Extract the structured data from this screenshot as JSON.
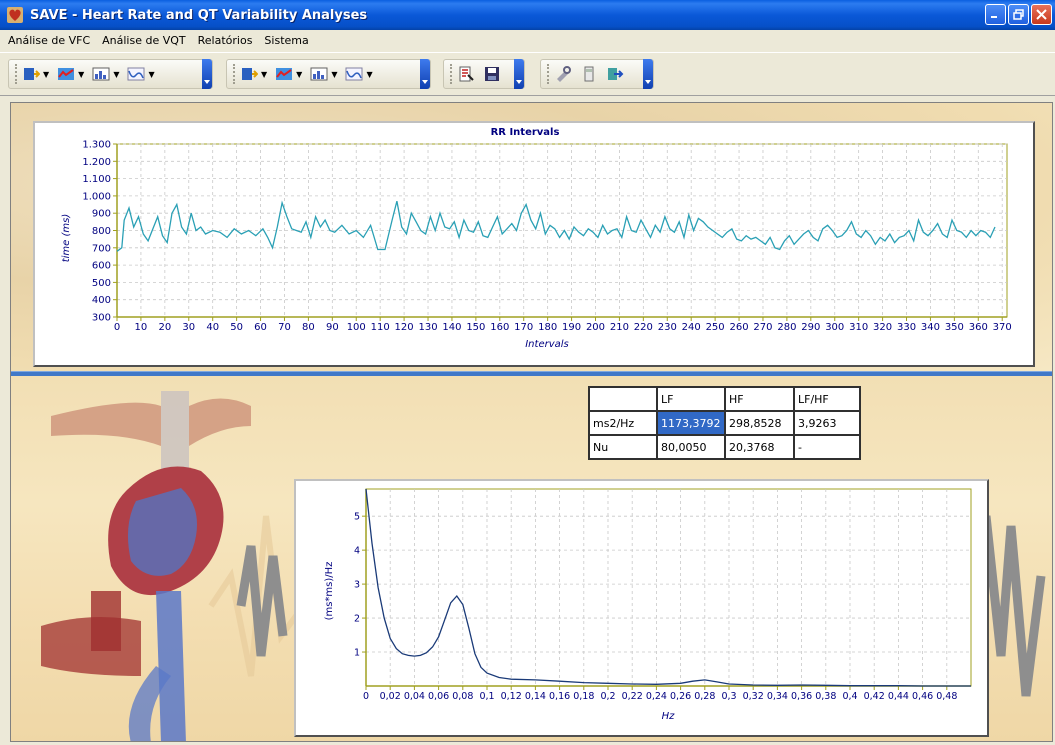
{
  "window": {
    "title": "SAVE - Heart Rate and QT Variability Analyses",
    "icon": "app-heart-icon"
  },
  "menu": {
    "items": [
      "Análise de VFC",
      "Análise de VQT",
      "Relatórios",
      "Sistema"
    ]
  },
  "toolbar": {
    "groups": [
      {
        "buttons": [
          "import-data-icon",
          "tachogram-icon",
          "histogram-icon",
          "spectrum-icon"
        ]
      },
      {
        "buttons": [
          "import-data-icon",
          "tachogram-icon",
          "histogram-icon",
          "spectrum-icon"
        ]
      },
      {
        "buttons": [
          "report-icon",
          "save-report-icon"
        ]
      },
      {
        "buttons": [
          "tools-icon",
          "calculator-icon",
          "exit-icon"
        ]
      }
    ]
  },
  "rr_chart": {
    "chart_data": {
      "type": "line",
      "title": "RR Intervals",
      "xlabel": "Intervals",
      "ylabel": "time (ms)",
      "xlim": [
        0,
        372
      ],
      "ylim": [
        300,
        1300
      ],
      "x_ticks": [
        "0",
        "10",
        "20",
        "30",
        "40",
        "50",
        "60",
        "70",
        "80",
        "90",
        "100",
        "110",
        "120",
        "130",
        "140",
        "150",
        "160",
        "170",
        "180",
        "190",
        "200",
        "210",
        "220",
        "230",
        "240",
        "250",
        "260",
        "270",
        "280",
        "290",
        "300",
        "310",
        "320",
        "330",
        "340",
        "350",
        "360",
        "370"
      ],
      "y_ticks": [
        "300",
        "400",
        "500",
        "600",
        "700",
        "800",
        "900",
        "1.000",
        "1.100",
        "1.200",
        "1.300"
      ],
      "series": [
        {
          "color": "#2aa0b5",
          "x": [
            0,
            2,
            3,
            5,
            7,
            9,
            11,
            13,
            15,
            17,
            19,
            21,
            23,
            25,
            27,
            29,
            31,
            33,
            35,
            37,
            40,
            43,
            46,
            49,
            52,
            55,
            58,
            61,
            63,
            65,
            67,
            69,
            71,
            73,
            75,
            77,
            79,
            81,
            83,
            85,
            87,
            89,
            91,
            94,
            97,
            100,
            103,
            106,
            109,
            112,
            115,
            117,
            119,
            121,
            123,
            125,
            127,
            129,
            131,
            133,
            135,
            137,
            139,
            141,
            143,
            145,
            147,
            149,
            151,
            153,
            155,
            157,
            159,
            161,
            163,
            165,
            167,
            169,
            171,
            173,
            175,
            177,
            179,
            181,
            183,
            185,
            187,
            189,
            191,
            193,
            195,
            197,
            199,
            201,
            203,
            205,
            207,
            209,
            211,
            213,
            215,
            217,
            219,
            221,
            223,
            225,
            227,
            229,
            231,
            233,
            235,
            237,
            239,
            241,
            243,
            245,
            247,
            249,
            251,
            253,
            255,
            257,
            259,
            261,
            263,
            265,
            267,
            269,
            271,
            273,
            275,
            277,
            279,
            281,
            283,
            285,
            287,
            289,
            291,
            293,
            295,
            297,
            299,
            301,
            303,
            305,
            307,
            309,
            311,
            313,
            315,
            317,
            319,
            321,
            323,
            325,
            327,
            329,
            331,
            333,
            335,
            337,
            339,
            341,
            343,
            345,
            347,
            349,
            351,
            353,
            355,
            357,
            359,
            361,
            363,
            365,
            367,
            369,
            371
          ],
          "y": [
            680,
            700,
            860,
            930,
            820,
            880,
            780,
            740,
            810,
            880,
            770,
            730,
            900,
            950,
            820,
            780,
            900,
            800,
            820,
            780,
            800,
            790,
            760,
            810,
            780,
            800,
            770,
            810,
            760,
            700,
            820,
            960,
            880,
            810,
            800,
            790,
            850,
            760,
            880,
            820,
            860,
            800,
            790,
            830,
            780,
            800,
            760,
            830,
            690,
            690,
            860,
            970,
            820,
            780,
            900,
            850,
            800,
            780,
            880,
            800,
            900,
            820,
            810,
            850,
            760,
            860,
            800,
            790,
            850,
            770,
            760,
            820,
            880,
            780,
            810,
            840,
            800,
            900,
            950,
            860,
            810,
            900,
            780,
            830,
            810,
            760,
            800,
            750,
            820,
            790,
            770,
            810,
            790,
            760,
            830,
            780,
            800,
            810,
            760,
            880,
            800,
            790,
            860,
            810,
            760,
            830,
            790,
            880,
            810,
            790,
            850,
            760,
            890,
            800,
            870,
            850,
            820,
            800,
            780,
            760,
            790,
            810,
            750,
            740,
            770,
            750,
            760,
            740,
            720,
            760,
            700,
            690,
            740,
            770,
            720,
            750,
            780,
            800,
            760,
            740,
            810,
            830,
            800,
            760,
            770,
            800,
            850,
            780,
            760,
            800,
            770,
            720,
            760,
            740,
            780,
            730,
            760,
            770,
            800,
            740,
            860,
            790,
            770,
            800,
            840,
            780,
            760,
            860,
            800,
            790,
            760,
            800,
            770,
            800,
            790,
            760,
            820
          ]
        }
      ]
    }
  },
  "spectral_table": {
    "headers": [
      "",
      "LF",
      "HF",
      "LF/HF"
    ],
    "rows": [
      [
        "ms2/Hz",
        "1173,3792",
        "298,8528",
        "3,9263"
      ],
      [
        "Nu",
        "80,0050",
        "20,3768",
        "-"
      ]
    ]
  },
  "psd_chart": {
    "chart_data": {
      "type": "line",
      "xlabel": "Hz",
      "ylabel": "(ms*ms)/Hz",
      "xlim": [
        0,
        0.5
      ],
      "ylim": [
        0,
        5.8
      ],
      "x_ticks": [
        "0",
        "0,02",
        "0,04",
        "0,06",
        "0,08",
        "0,1",
        "0,12",
        "0,14",
        "0,16",
        "0,18",
        "0,2",
        "0,22",
        "0,24",
        "0,26",
        "0,28",
        "0,3",
        "0,32",
        "0,34",
        "0,36",
        "0,38",
        "0,4",
        "0,42",
        "0,44",
        "0,46",
        "0,48"
      ],
      "y_ticks": [
        "1",
        "2",
        "3",
        "4",
        "5"
      ],
      "series": [
        {
          "color": "#1a3a78",
          "x": [
            0,
            0.005,
            0.01,
            0.015,
            0.02,
            0.025,
            0.03,
            0.035,
            0.04,
            0.045,
            0.05,
            0.055,
            0.06,
            0.065,
            0.07,
            0.075,
            0.08,
            0.085,
            0.09,
            0.095,
            0.1,
            0.11,
            0.12,
            0.14,
            0.16,
            0.18,
            0.2,
            0.22,
            0.24,
            0.26,
            0.27,
            0.28,
            0.29,
            0.3,
            0.32,
            0.34,
            0.36,
            0.38,
            0.4,
            0.42,
            0.44,
            0.46,
            0.48,
            0.5
          ],
          "y": [
            5.8,
            4.2,
            2.9,
            2.0,
            1.4,
            1.1,
            0.95,
            0.9,
            0.88,
            0.9,
            0.98,
            1.15,
            1.45,
            1.95,
            2.45,
            2.65,
            2.4,
            1.7,
            0.95,
            0.55,
            0.38,
            0.25,
            0.2,
            0.18,
            0.14,
            0.1,
            0.08,
            0.06,
            0.05,
            0.08,
            0.14,
            0.18,
            0.12,
            0.06,
            0.03,
            0.02,
            0.03,
            0.02,
            0.01,
            0.01,
            0.01,
            0.0,
            0.0,
            0.0
          ]
        }
      ]
    }
  }
}
